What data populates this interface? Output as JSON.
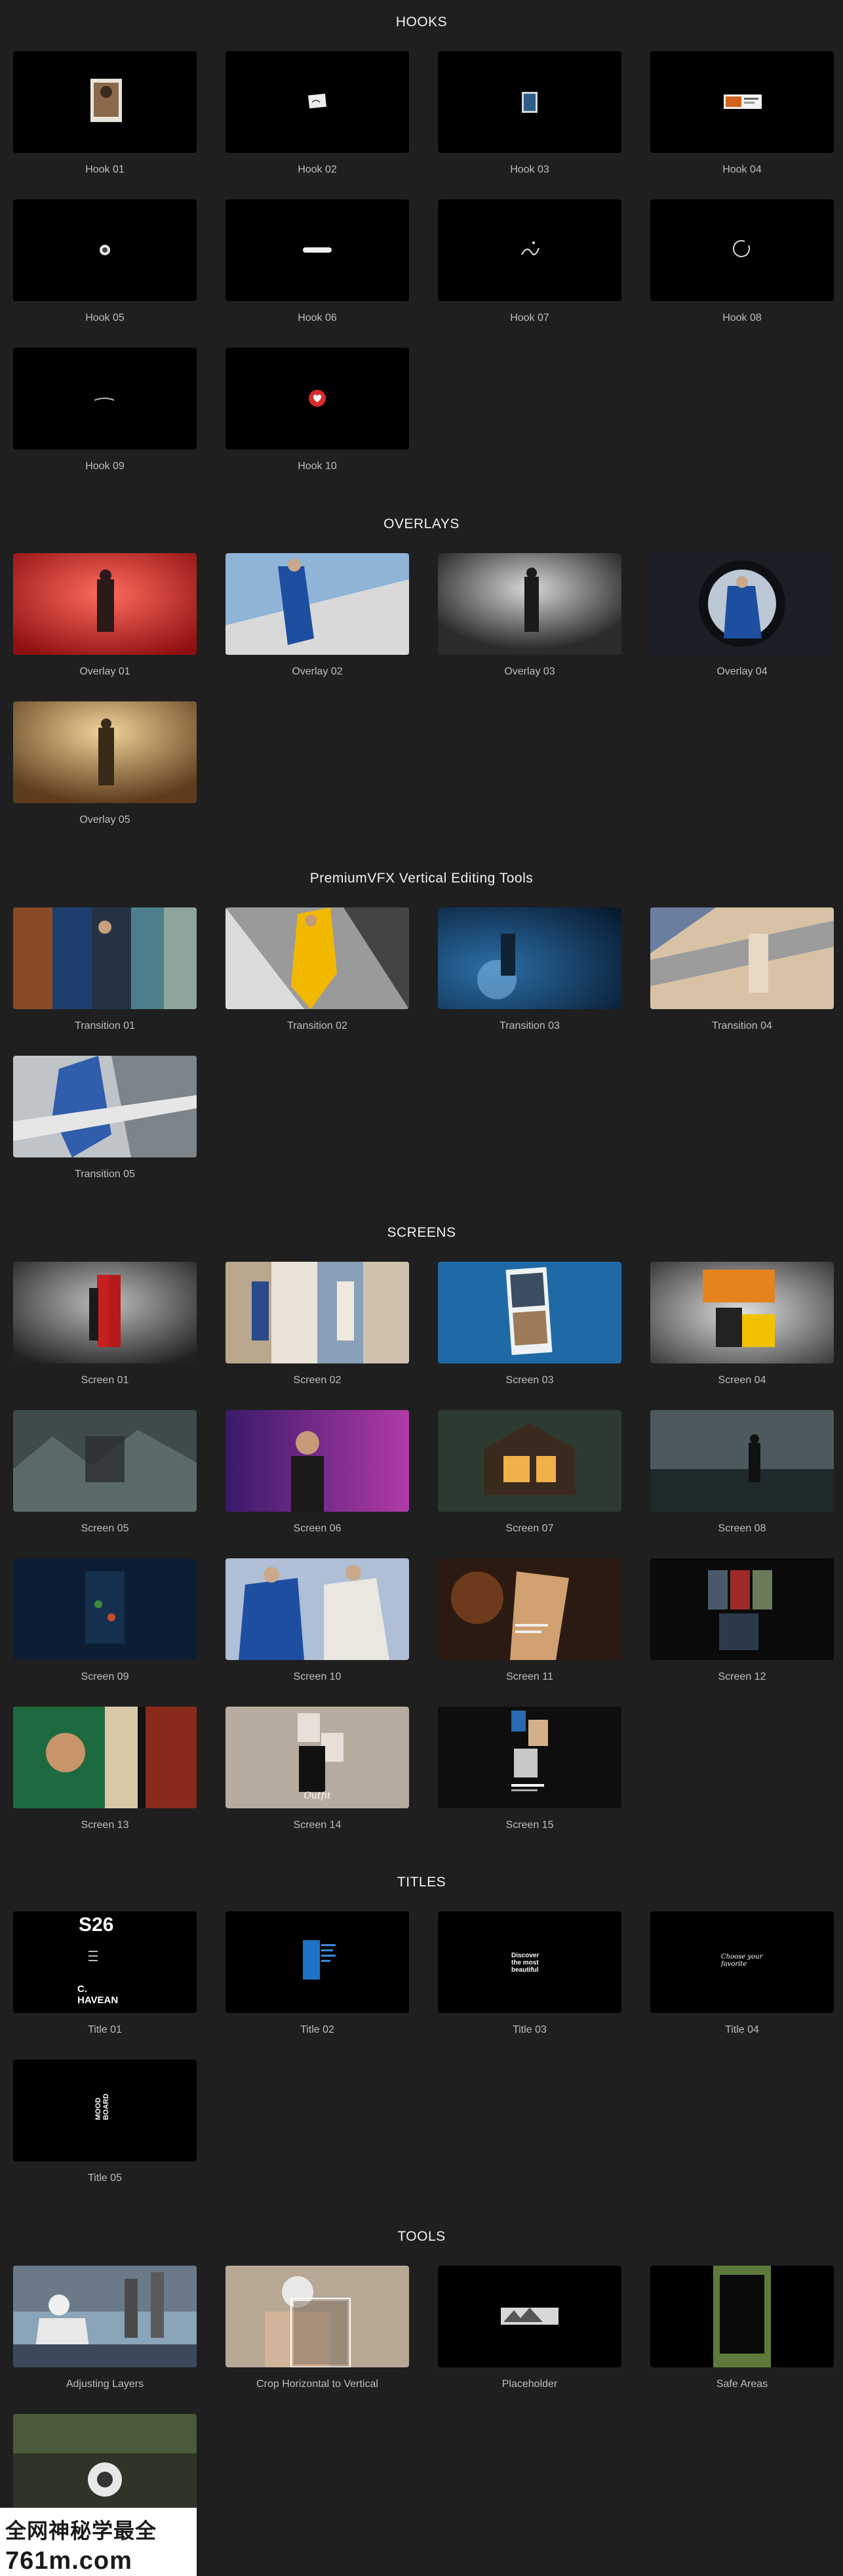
{
  "sections": {
    "hooks": {
      "title": "HOOKS",
      "items": [
        "Hook 01",
        "Hook 02",
        "Hook 03",
        "Hook 04",
        "Hook 05",
        "Hook 06",
        "Hook 07",
        "Hook 08",
        "Hook 09",
        "Hook 10"
      ]
    },
    "overlays": {
      "title": "OVERLAYS",
      "items": [
        "Overlay 01",
        "Overlay 02",
        "Overlay 03",
        "Overlay 04",
        "Overlay 05"
      ]
    },
    "transitions": {
      "title": "PremiumVFX Vertical Editing Tools",
      "items": [
        "Transition 01",
        "Transition 02",
        "Transition 03",
        "Transition 04",
        "Transition 05"
      ]
    },
    "screens": {
      "title": "SCREENS",
      "items": [
        "Screen 01",
        "Screen 02",
        "Screen 03",
        "Screen 04",
        "Screen 05",
        "Screen 06",
        "Screen 07",
        "Screen 08",
        "Screen 09",
        "Screen 10",
        "Screen 11",
        "Screen 12",
        "Screen 13",
        "Screen 14",
        "Screen 15"
      ]
    },
    "titles": {
      "title": "TITLES",
      "items": [
        "Title 01",
        "Title 02",
        "Title 03",
        "Title 04",
        "Title 05"
      ],
      "title01_big": "S26",
      "title01_name": "C.\nHAVEAN",
      "title03_text": "Discover\nthe most\nbeautiful",
      "title04_text": "Choose your\nfavorite",
      "title05_text": "MOOD\nBOARD"
    },
    "tools": {
      "title": "TOOLS",
      "items": [
        "Adjusting Layers",
        "Crop Horizontal to Vertical",
        "Placeholder",
        "Safe Areas",
        ""
      ]
    }
  },
  "watermark": {
    "line1": "全网神秘学最全",
    "line2": "761m.com"
  },
  "colors": {
    "background": "#1f1f1f",
    "caption": "#bdbdbd",
    "heading": "#f2f2f2",
    "accent_red": "#d92b2b",
    "accent_blue": "#1f5aa8"
  }
}
